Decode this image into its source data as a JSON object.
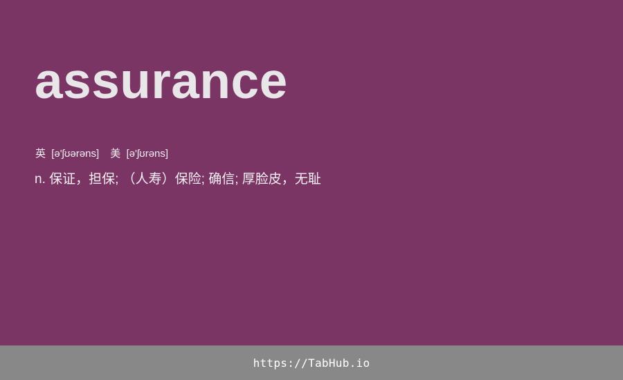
{
  "entry": {
    "word": "assurance",
    "phonetics": {
      "uk": {
        "region": "英",
        "ipa": "[ə'ʃʊərəns]"
      },
      "us": {
        "region": "美",
        "ipa": "[ə'ʃʊrəns]"
      }
    },
    "definition": "n. 保证，担保; （人寿）保险; 确信; 厚脸皮，无耻"
  },
  "footer": {
    "link_text": "https://TabHub.io"
  },
  "colors": {
    "background": "#7a3564",
    "footer_background": "#888888",
    "text": "#e8e6e8"
  }
}
